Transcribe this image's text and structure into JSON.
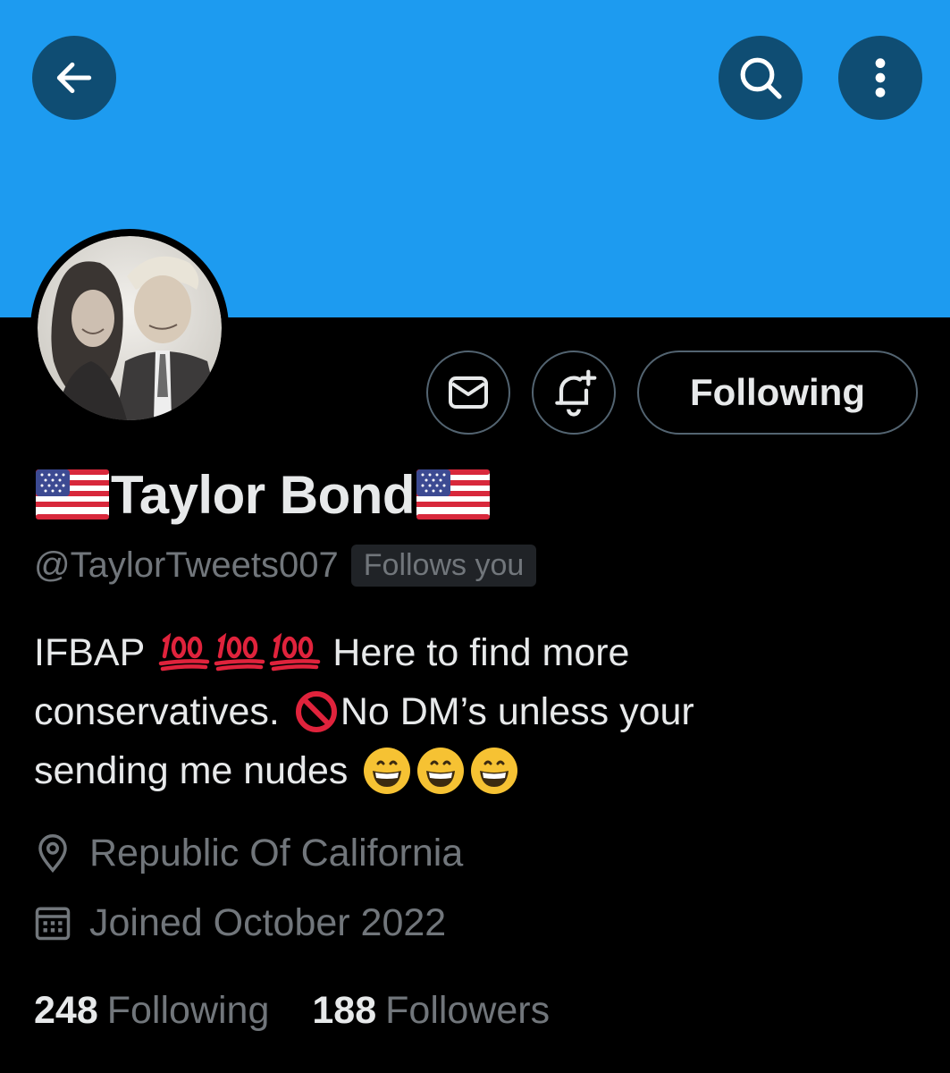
{
  "header": {
    "back_icon": "arrow-left-icon",
    "search_icon": "search-icon",
    "more_icon": "more-vertical-icon",
    "banner_color": "#1d9bf0"
  },
  "actions": {
    "message_icon": "envelope-icon",
    "notify_icon": "bell-plus-icon",
    "follow_label": "Following"
  },
  "profile": {
    "name": "Taylor Bond",
    "name_flag_icon": "us-flag-icon",
    "handle": "@TaylorTweets007",
    "follows_you": "Follows you",
    "bio": {
      "line1_a": "IFBAP",
      "line1_b": "Here to find more",
      "line2_a": "conservatives.",
      "line2_b": "No DM’s unless your",
      "line3_a": "sending me nudes"
    },
    "location": "Republic Of California",
    "joined": "Joined October 2022"
  },
  "stats": {
    "following_count": "248",
    "following_label": "Following",
    "followers_count": "188",
    "followers_label": "Followers"
  }
}
